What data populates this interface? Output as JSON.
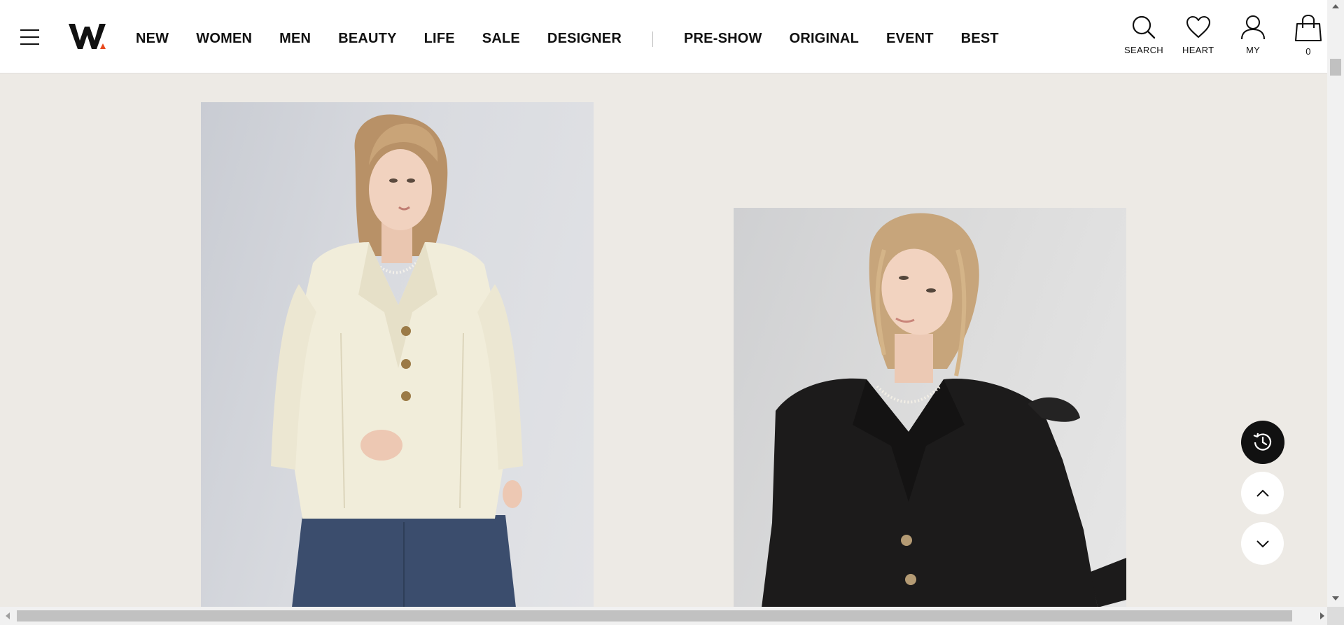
{
  "brand": {
    "name": "W",
    "accent_color": "#e8491d"
  },
  "nav": {
    "primary": [
      "NEW",
      "WOMEN",
      "MEN",
      "BEAUTY",
      "LIFE",
      "SALE",
      "DESIGNER"
    ],
    "secondary": [
      "PRE-SHOW",
      "ORIGINAL",
      "EVENT",
      "BEST"
    ]
  },
  "utilities": {
    "search": {
      "label": "SEARCH",
      "icon": "search-icon"
    },
    "heart": {
      "label": "HEART",
      "icon": "heart-icon"
    },
    "my": {
      "label": "MY",
      "icon": "user-icon"
    },
    "cart": {
      "label": "0",
      "icon": "shopping-bag-icon"
    }
  },
  "products": [
    {
      "image": "model wearing ivory tweed jacket with gold buttons",
      "color": "#f1edda"
    },
    {
      "image": "model wearing black tweed jacket with pearl necklace",
      "color": "#1c1b1b"
    }
  ],
  "floating_buttons": {
    "history": "history-icon",
    "scroll_up": "chevron-up-icon",
    "scroll_down": "chevron-down-icon"
  },
  "colors": {
    "background": "#edeae5",
    "header_bg": "#ffffff",
    "text": "#111111"
  }
}
